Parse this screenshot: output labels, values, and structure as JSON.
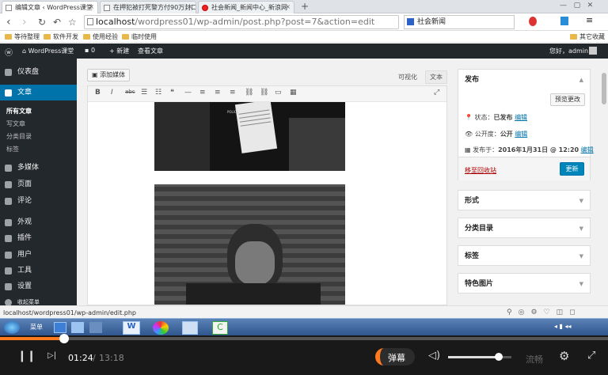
{
  "browser": {
    "tabs": [
      {
        "label": "编辑文章 ‹ WordPress课堂"
      },
      {
        "label": "在押犯被打死警方付90万封口"
      },
      {
        "label": "社会新闻_新闻中心_新浪网"
      }
    ],
    "url_host": "localhost",
    "url_path": "/wordpress01/wp-admin/post.php?post=7&action=edit",
    "search_text": "社会新闻",
    "bookmarks": [
      "等待整理",
      "软件开发",
      "使用经验",
      "临时使用"
    ],
    "mobile_bookmarks": "其它收藏"
  },
  "wp_admin_bar": {
    "site_name": "WordPress课堂",
    "comments_count": "0",
    "new_label": "新建",
    "view_post": "查看文章",
    "greeting": "您好，admin"
  },
  "sidebar": {
    "items": [
      {
        "label": "仪表盘"
      },
      {
        "label": "文章"
      },
      {
        "label": "多媒体"
      },
      {
        "label": "页面"
      },
      {
        "label": "评论"
      },
      {
        "label": "外观"
      },
      {
        "label": "插件"
      },
      {
        "label": "用户"
      },
      {
        "label": "工具"
      },
      {
        "label": "设置"
      },
      {
        "label": "收起菜单"
      }
    ],
    "submenu": [
      "所有文章",
      "写文章",
      "分类目录",
      "标签"
    ]
  },
  "editor": {
    "add_media": "添加媒体",
    "tab_visual": "可视化",
    "tab_text": "文本",
    "paper_sign": "POLICE"
  },
  "publish": {
    "title": "发布",
    "preview": "预览更改",
    "status_label": "状态：",
    "status_value": "已发布",
    "visibility_label": "公开度：",
    "visibility_value": "公开",
    "published_label": "发布于：",
    "published_value": "2016年1月31日 @ 12:20",
    "edit_link": "编辑",
    "trash": "移至回收站",
    "update": "更新"
  },
  "boxes": [
    "形式",
    "分类目录",
    "标签",
    "特色图片"
  ],
  "status_url": "localhost/wordpress01/wp-admin/edit.php",
  "taskbar": {
    "menu_label": "菜单"
  },
  "player": {
    "current_time": "01:24",
    "duration": "13:18",
    "progress": 0.105,
    "danmaku": "弹幕",
    "quality": "流畅",
    "volume": 0.8
  }
}
